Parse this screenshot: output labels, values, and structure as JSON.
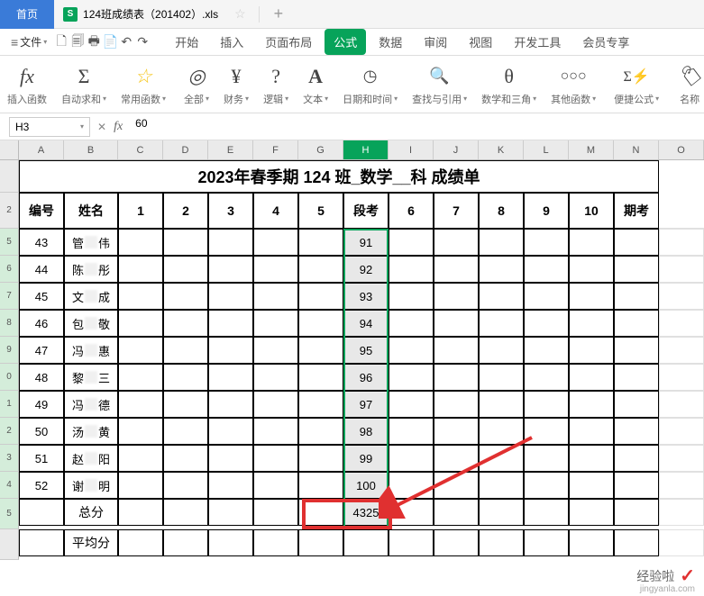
{
  "app": {
    "home_tab": "首页",
    "file_icon": "S",
    "file_name": "124班成绩表（201402）.xls",
    "plus": "+"
  },
  "menu": {
    "file_label": "文件",
    "tabs": [
      "开始",
      "插入",
      "页面布局",
      "公式",
      "数据",
      "审阅",
      "视图",
      "开发工具",
      "会员专享"
    ],
    "active_tab": "公式"
  },
  "ribbon": {
    "insert_fn": "插入函数",
    "autosum": "自动求和",
    "common": "常用函数",
    "all": "全部",
    "finance": "财务",
    "logic": "逻辑",
    "text": "文本",
    "datetime": "日期和时间",
    "lookup": "查找与引用",
    "math": "数学和三角",
    "other": "其他函数",
    "quick": "便捷公式",
    "name": "名称"
  },
  "formula_bar": {
    "name_box": "H3",
    "fx": "fx",
    "value": "60"
  },
  "chart_data": {
    "type": "table",
    "title": "2023年春季期 124 班_数学__科 成绩单",
    "columns": [
      "编号",
      "姓名",
      "1",
      "2",
      "3",
      "4",
      "5",
      "段考",
      "6",
      "7",
      "8",
      "9",
      "10",
      "期考"
    ],
    "col_letters": [
      "A",
      "B",
      "C",
      "D",
      "E",
      "F",
      "G",
      "H",
      "I",
      "J",
      "K",
      "L",
      "M",
      "N",
      "O"
    ],
    "rows_visible": [
      {
        "num": "5",
        "id": "43",
        "name_prefix": "管",
        "name_suffix": "伟",
        "h": "91"
      },
      {
        "num": "6",
        "id": "44",
        "name_prefix": "陈",
        "name_suffix": "彤",
        "h": "92"
      },
      {
        "num": "7",
        "id": "45",
        "name_prefix": "文",
        "name_suffix": "成",
        "h": "93"
      },
      {
        "num": "8",
        "id": "46",
        "name_prefix": "包",
        "name_suffix": "敬",
        "h": "94"
      },
      {
        "num": "9",
        "id": "47",
        "name_prefix": "冯",
        "name_suffix": "惠",
        "h": "95"
      },
      {
        "num": "0",
        "id": "48",
        "name_prefix": "黎",
        "name_suffix": "三",
        "h": "96"
      },
      {
        "num": "1",
        "id": "49",
        "name_prefix": "冯",
        "name_suffix": "德",
        "h": "97"
      },
      {
        "num": "2",
        "id": "50",
        "name_prefix": "汤",
        "name_suffix": "黄",
        "h": "98"
      },
      {
        "num": "3",
        "id": "51",
        "name_prefix": "赵",
        "name_suffix": "阳",
        "h": "99"
      },
      {
        "num": "4",
        "id": "52",
        "name_prefix": "谢",
        "name_suffix": "明",
        "h": "100"
      }
    ],
    "sum_label": "总分",
    "sum_value": "4325",
    "avg_label": "平均分",
    "sum_row_num": "5",
    "avg_row_num": ""
  },
  "watermark": {
    "text": "经验啦",
    "sub": "jingyanla.com"
  }
}
